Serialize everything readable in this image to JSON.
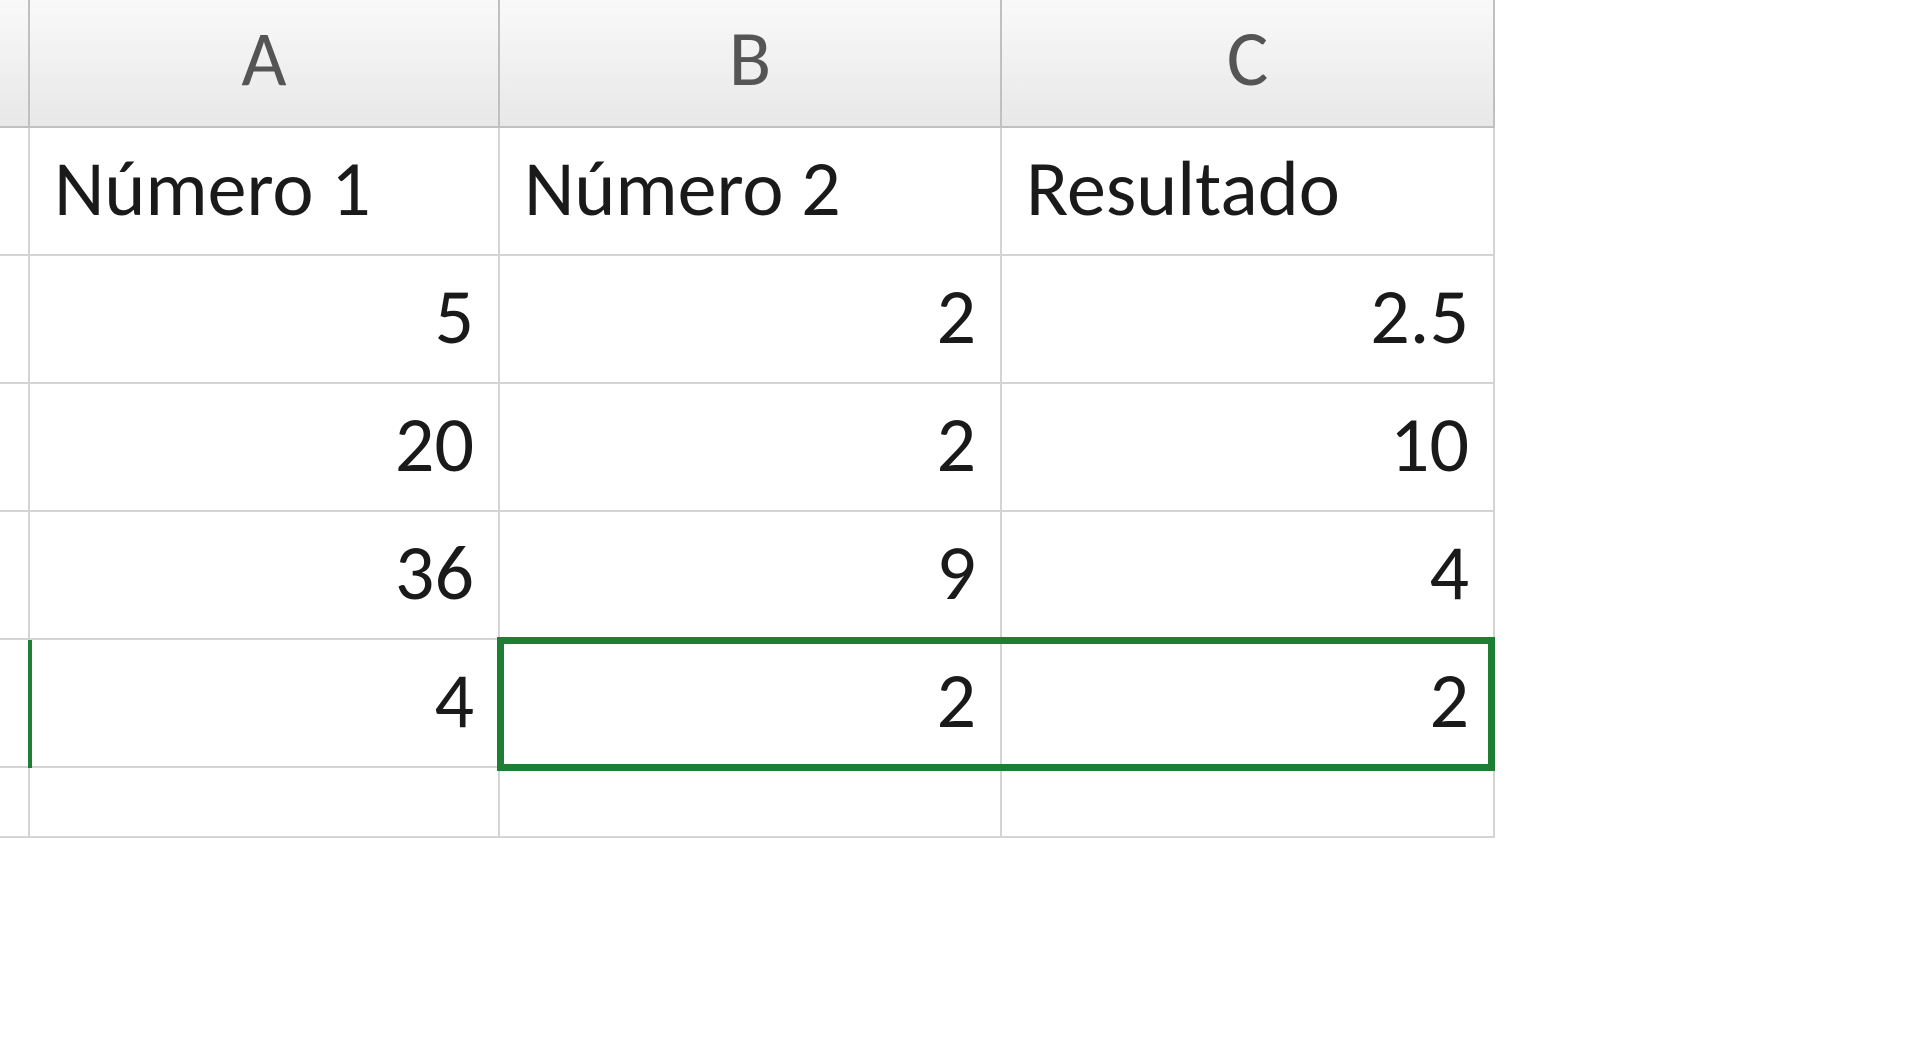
{
  "columns": [
    "A",
    "B",
    "C"
  ],
  "headers": {
    "col_a": "Número 1",
    "col_b": "Número 2",
    "col_c": "Resultado"
  },
  "rows": [
    {
      "a": "5",
      "b": "2",
      "c": "2.5"
    },
    {
      "a": "20",
      "b": "2",
      "c": "10"
    },
    {
      "a": "36",
      "b": "9",
      "c": "4"
    },
    {
      "a": "4",
      "b": "2",
      "c": "2"
    }
  ],
  "selection": {
    "range": "B5:C5"
  }
}
